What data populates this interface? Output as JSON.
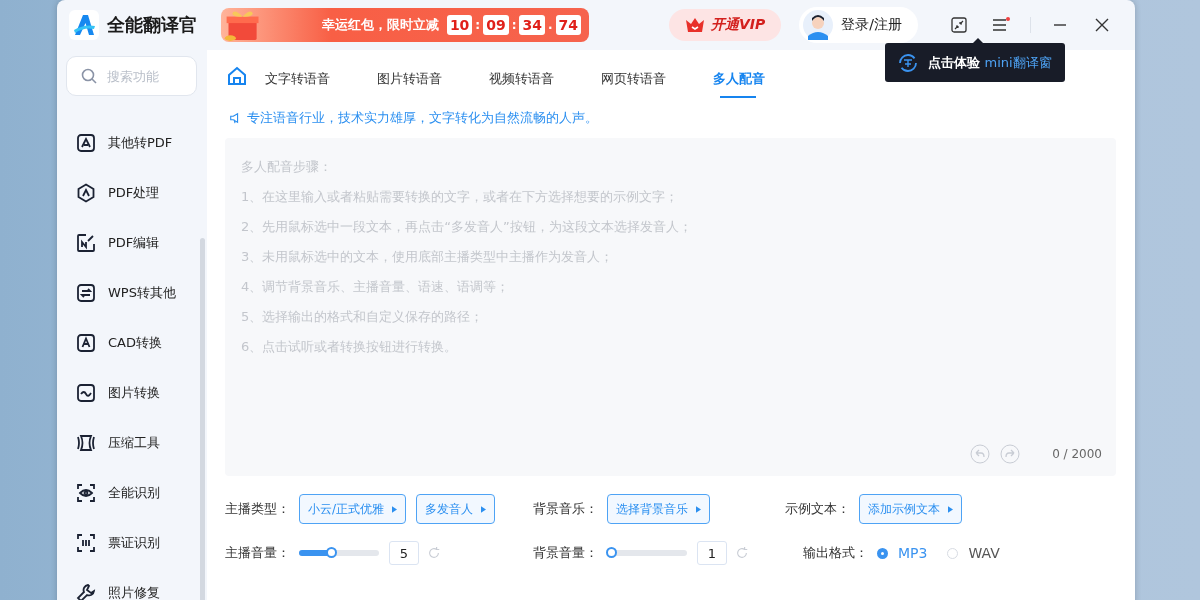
{
  "app": {
    "name": "全能翻译官"
  },
  "promo": {
    "text": "幸运红包，限时立减",
    "countdown": [
      "10",
      "09",
      "34",
      "74"
    ],
    "separators": [
      ":",
      ":",
      "."
    ]
  },
  "header": {
    "vip_label": "开通VIP",
    "login_label": "登录/注册"
  },
  "tooltip": {
    "text": "点击体验",
    "highlight": "mini翻译窗"
  },
  "search": {
    "placeholder": "搜索功能"
  },
  "sidebar": {
    "items": [
      {
        "label": "其他转PDF"
      },
      {
        "label": "PDF处理"
      },
      {
        "label": "PDF编辑"
      },
      {
        "label": "WPS转其他"
      },
      {
        "label": "CAD转换"
      },
      {
        "label": "图片转换"
      },
      {
        "label": "压缩工具"
      },
      {
        "label": "全能识别"
      },
      {
        "label": "票证识别"
      },
      {
        "label": "照片修复"
      }
    ]
  },
  "tabs": [
    {
      "label": "文字转语音",
      "selected": false
    },
    {
      "label": "图片转语音",
      "selected": false
    },
    {
      "label": "视频转语音",
      "selected": false
    },
    {
      "label": "网页转语音",
      "selected": false
    },
    {
      "label": "多人配音",
      "selected": true
    }
  ],
  "tagline": "专注语音行业，技术实力雄厚，文字转化为自然流畅的人声。",
  "editor": {
    "placeholder_lines": [
      "多人配音步骤：",
      "1、在这里输入或者粘贴需要转换的文字，或者在下方选择想要的示例文字；",
      "2、先用鼠标选中一段文本，再点击“多发音人”按钮，为这段文本选择发音人；",
      "3、未用鼠标选中的文本，使用底部主播类型中主播作为发音人；",
      "4、调节背景音乐、主播音量、语速、语调等；",
      "5、选择输出的格式和自定义保存的路径；",
      "6、点击试听或者转换按钮进行转换。"
    ],
    "counter": "0 / 2000"
  },
  "controls": {
    "anchor_type": {
      "label": "主播类型：",
      "buttons": [
        "小云/正式优雅",
        "多发音人"
      ]
    },
    "bg_music": {
      "label": "背景音乐：",
      "button": "选择背景音乐"
    },
    "sample_text": {
      "label": "示例文本：",
      "button": "添加示例文本"
    },
    "anchor_volume": {
      "label": "主播音量：",
      "level": 0.4,
      "value": "5"
    },
    "bg_volume": {
      "label": "背景音量：",
      "level": 0.05,
      "value": "1"
    },
    "output_format": {
      "label": "输出格式：",
      "options": [
        {
          "label": "MP3",
          "selected": true
        },
        {
          "label": "WAV",
          "selected": false
        }
      ]
    }
  }
}
